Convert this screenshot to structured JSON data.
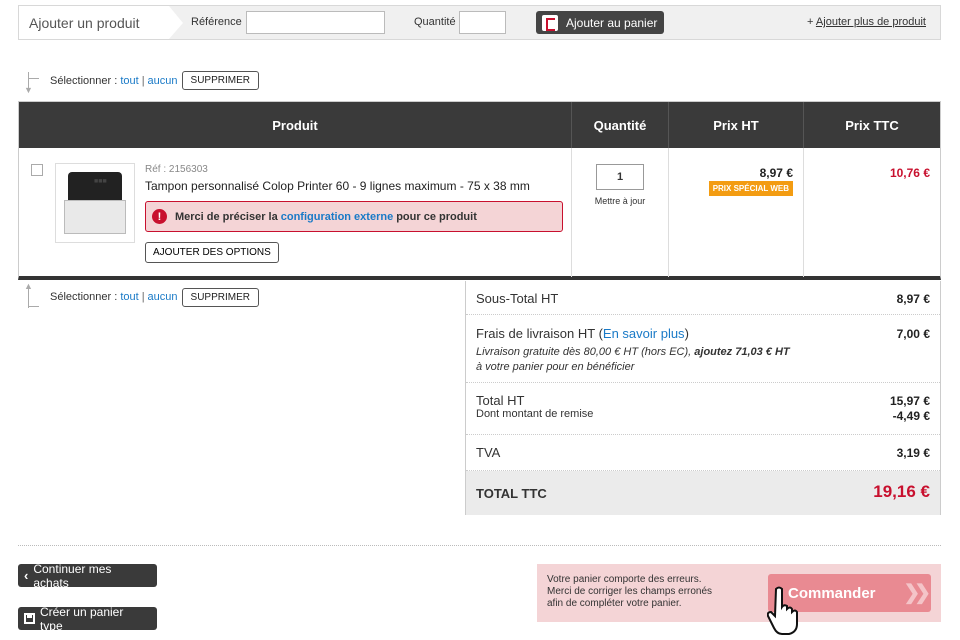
{
  "add_bar": {
    "title": "Ajouter un produit",
    "reference_label": "Référence",
    "reference_value": "",
    "quantity_label": "Quantité",
    "quantity_value": "",
    "add_to_cart_label": "Ajouter au panier",
    "more_products_prefix": "+ ",
    "more_products_link": "Ajouter plus de produit"
  },
  "select_bar": {
    "label": "Sélectionner :",
    "all": "tout",
    "separator": "|",
    "none": "aucun",
    "delete": "SUPPRIMER"
  },
  "table": {
    "columns": [
      "Produit",
      "Quantité",
      "Prix HT",
      "Prix TTC"
    ],
    "rows": [
      {
        "ref": "Réf : 2156303",
        "name": "Tampon personnalisé Colop Printer 60 - 9 lignes maximum - 75 x 38 mm",
        "error_before": "Merci de préciser la",
        "error_link": "configuration externe",
        "error_after": "pour ce produit",
        "options_button": "AJOUTER DES OPTIONS",
        "quantity": "1",
        "delivery": "Mettre à jour",
        "price_ht": "8,97 €",
        "badge": "PRIX SPÉCIAL WEB",
        "price_ttc": "10,76 €"
      }
    ]
  },
  "totals": {
    "subtotal_label": "Sous-Total HT",
    "subtotal_value": "8,97 €",
    "shipping_label": "Frais de livraison HT (",
    "shipping_link": "En savoir plus",
    "shipping_label_end": ")",
    "shipping_value": "7,00 €",
    "shipping_note_1": "Livraison gratuite dès 80,00 € HT (hors EC), ",
    "shipping_note_bold": "ajoutez 71,03 € HT",
    "shipping_note_2": "à votre panier pour en bénéficier",
    "total_ht_label": "Total HT",
    "total_ht_value": "15,97 €",
    "discount_label": "Dont montant de remise",
    "discount_value": "-4,49 €",
    "tva_label": "TVA",
    "tva_value": "3,19 €",
    "ttc_label": "TOTAL TTC",
    "ttc_value": "19,16 €"
  },
  "footer": {
    "continue_label": "Continuer mes achats",
    "template_cart_label": "Créer un panier type",
    "error_line_1": "Votre panier comporte des erreurs.",
    "error_line_2": "Merci de corriger les champs erronés",
    "error_line_3": "afin de compléter votre panier.",
    "order_label": "Commander"
  },
  "colors": {
    "accent_red": "#c8102e",
    "link_blue": "#1a7ac7",
    "badge_orange": "#f39c12",
    "header_dark": "#3a3a3a"
  }
}
